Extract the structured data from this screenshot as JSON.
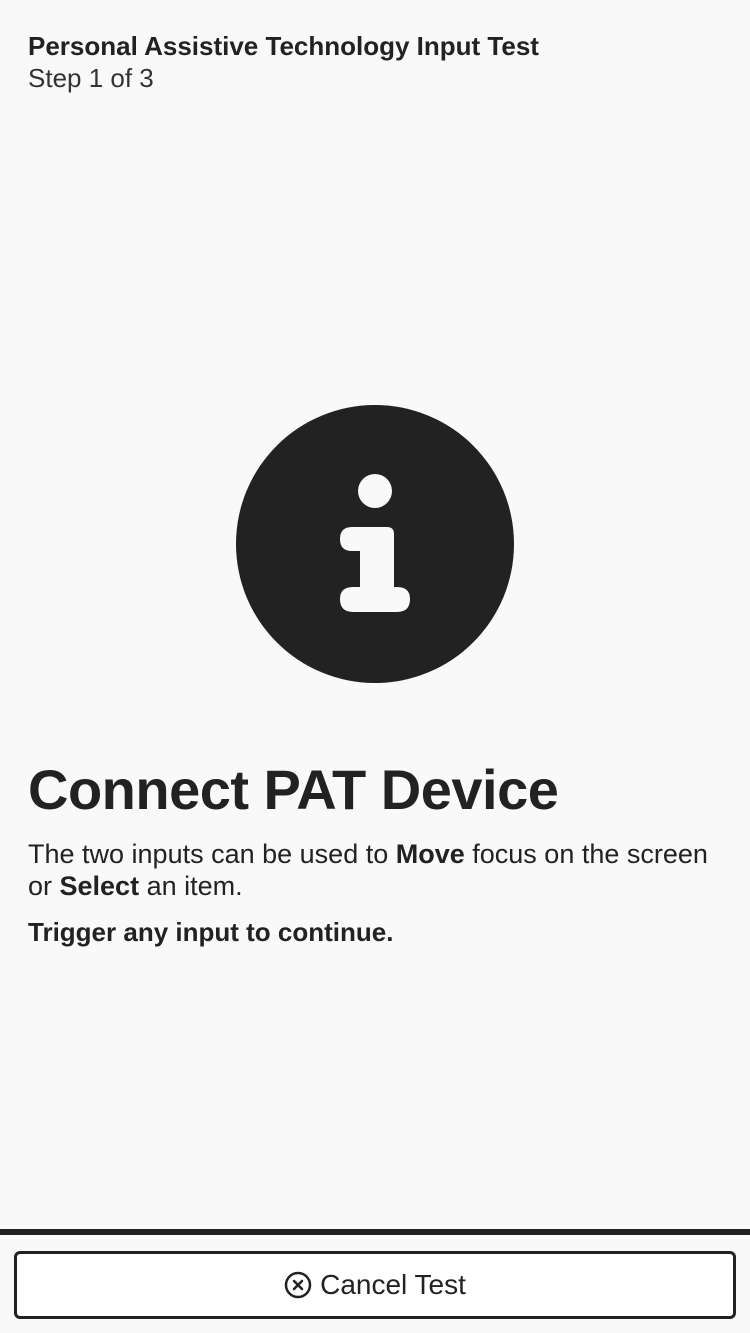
{
  "header": {
    "title": "Personal Assistive Technology Input Test",
    "step": "Step 1 of 3"
  },
  "icon": {
    "name": "info-icon",
    "color": "#222222",
    "glyph_color": "#f9f9f9"
  },
  "main": {
    "title": "Connect PAT Device",
    "description": {
      "part1": "The two inputs can be used to ",
      "bold1": "Move",
      "part2": " focus on the screen or ",
      "bold2": "Select",
      "part3": " an item."
    },
    "prompt": "Trigger any input to continue."
  },
  "footer": {
    "cancel_label": "Cancel Test",
    "cancel_icon": "close-circle-icon"
  },
  "colors": {
    "background": "#f9f9f9",
    "text": "#222222",
    "button_bg": "#ffffff"
  }
}
